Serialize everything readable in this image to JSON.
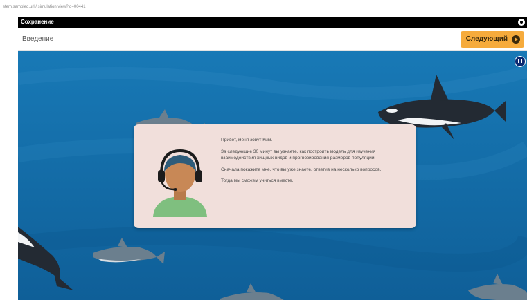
{
  "browser": {
    "url": "stem.sampled.url / simulation.view?id=00441"
  },
  "titlebar": {
    "title": "Сохранение"
  },
  "nav": {
    "section_title": "Введение",
    "next_label": "Следующий"
  },
  "media": {
    "pause_label": "Пауза"
  },
  "dialog": {
    "greeting": "Привет, меня зовут Ким.",
    "p1": "За следующие 30 минут вы узнаете, как построить модель для изучения взаимодействия хищных видов и прогнозирования размеров популяций.",
    "p2": "Сначала покажите мне, что вы уже знаете, ответив на несколько вопросов.",
    "p3": "Тогда мы сможем учиться вместе."
  },
  "colors": {
    "accent": "#f6ab3c",
    "ocean": "#1472ad",
    "dialog_bg": "#f1dfdb",
    "titlebar": "#000000"
  },
  "icons": [
    "settings-icon",
    "chevron-right-icon",
    "pause-icon",
    "headset-avatar"
  ]
}
